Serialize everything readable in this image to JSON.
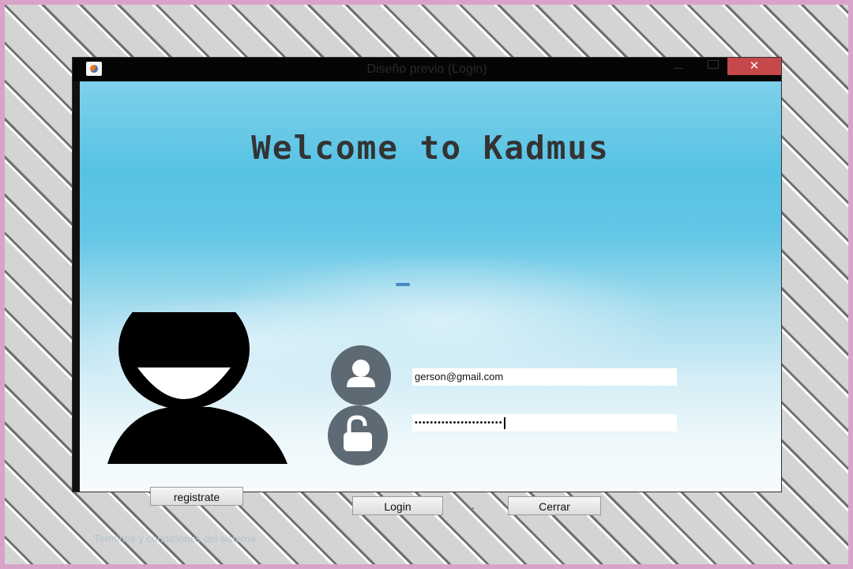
{
  "window": {
    "title": "Diseño previo (Login)",
    "close_glyph": "✕"
  },
  "main": {
    "heading": "Welcome to Kadmus"
  },
  "form": {
    "email_value": "gerson@gmail.com",
    "password_value": "•••••••••••••••••••••••",
    "user_icon": "user-icon",
    "lock_icon": "unlock-icon"
  },
  "buttons": {
    "registrate": "registrate",
    "login": "Login",
    "cerrar": "Cerrar",
    "separator": "."
  },
  "footer": {
    "terms_link": "Terminos y condiciones del sistema"
  },
  "colors": {
    "close_button": "#c7484a",
    "icon_circle": "#5d6a74",
    "sky_blue": "#56c2e4"
  }
}
